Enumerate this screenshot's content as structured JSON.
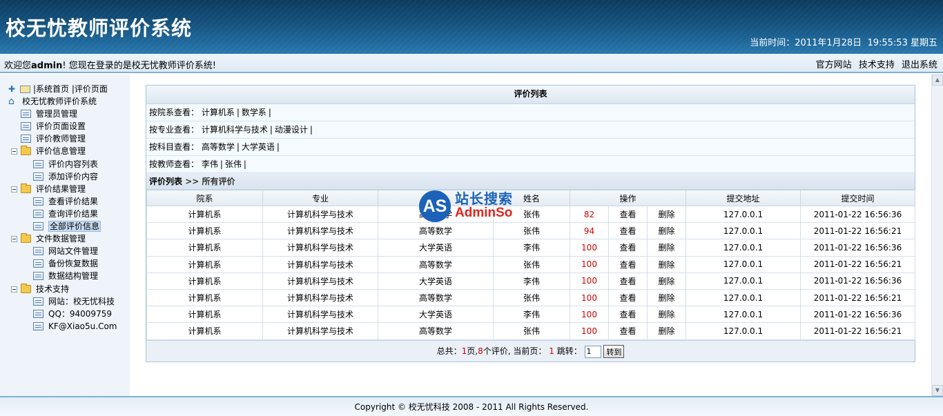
{
  "header": {
    "title": "校无忧教师评价系统",
    "clock_label": "当前时间：",
    "clock_date": "2011年1月28日",
    "clock_time": "19:55:53",
    "clock_weekday": "星期五"
  },
  "welcome": {
    "prefix": "欢迎您",
    "user": "admin",
    "suffix": "! 您现在登录的是校无忧教师评价系统!",
    "links": [
      "官方网站",
      "技术支持",
      "退出系统"
    ]
  },
  "sidebar": {
    "top_links": [
      "系统首页",
      "评价页面"
    ],
    "root": "校无忧教师评价系统",
    "items": [
      {
        "label": "管理员管理",
        "level": 1,
        "type": "doc"
      },
      {
        "label": "评价页面设置",
        "level": 1,
        "type": "doc"
      },
      {
        "label": "评价教师管理",
        "level": 1,
        "type": "doc"
      },
      {
        "label": "评价信息管理",
        "level": 1,
        "type": "folder"
      },
      {
        "label": "评价内容列表",
        "level": 2,
        "type": "doc"
      },
      {
        "label": "添加评价内容",
        "level": 2,
        "type": "doc"
      },
      {
        "label": "评价结果管理",
        "level": 1,
        "type": "folder"
      },
      {
        "label": "查看评价结果",
        "level": 2,
        "type": "doc"
      },
      {
        "label": "查询评价结果",
        "level": 2,
        "type": "doc"
      },
      {
        "label": "全部评价信息",
        "level": 2,
        "type": "doc",
        "active": true
      },
      {
        "label": "文件数据管理",
        "level": 1,
        "type": "folder"
      },
      {
        "label": "网站文件管理",
        "level": 2,
        "type": "doc"
      },
      {
        "label": "备份恢复数据",
        "level": 2,
        "type": "doc"
      },
      {
        "label": "数据结构管理",
        "level": 2,
        "type": "doc"
      },
      {
        "label": "技术支持",
        "level": 1,
        "type": "folder"
      },
      {
        "label": "网站：校无忧科技",
        "level": 2,
        "type": "doc"
      },
      {
        "label": "QQ：94009759",
        "level": 2,
        "type": "doc"
      },
      {
        "label": "KF@Xiao5u.Com",
        "level": 2,
        "type": "doc"
      }
    ]
  },
  "panel": {
    "title": "评价列表",
    "filters": [
      {
        "label": "按院系查看：",
        "options": [
          "计算机系",
          "数学系"
        ]
      },
      {
        "label": "按专业查看：",
        "options": [
          "计算机科学与技术",
          "动漫设计"
        ]
      },
      {
        "label": "按科目查看：",
        "options": [
          "高等数学",
          "大学英语"
        ]
      },
      {
        "label": "按教师查看：",
        "options": [
          "李伟",
          "张伟"
        ]
      }
    ],
    "crumb_main": "评价列表",
    "crumb_sub": ">> 所有评价",
    "columns": [
      "院系",
      "专业",
      "科目",
      "姓名",
      "操作",
      "提交地址",
      "提交时间"
    ],
    "view_label": "查看",
    "delete_label": "删除",
    "rows": [
      {
        "dept": "计算机系",
        "major": "计算机科学与技术",
        "subject": "高等数学",
        "teacher": "张伟",
        "score": "82",
        "ip": "127.0.0.1",
        "time": "2011-01-22 16:56:36"
      },
      {
        "dept": "计算机系",
        "major": "计算机科学与技术",
        "subject": "高等数学",
        "teacher": "张伟",
        "score": "94",
        "ip": "127.0.0.1",
        "time": "2011-01-22 16:56:21"
      },
      {
        "dept": "计算机系",
        "major": "计算机科学与技术",
        "subject": "大学英语",
        "teacher": "李伟",
        "score": "100",
        "ip": "127.0.0.1",
        "time": "2011-01-22 16:56:36"
      },
      {
        "dept": "计算机系",
        "major": "计算机科学与技术",
        "subject": "高等数学",
        "teacher": "张伟",
        "score": "100",
        "ip": "127.0.0.1",
        "time": "2011-01-22 16:56:21"
      },
      {
        "dept": "计算机系",
        "major": "计算机科学与技术",
        "subject": "大学英语",
        "teacher": "李伟",
        "score": "100",
        "ip": "127.0.0.1",
        "time": "2011-01-22 16:56:36"
      },
      {
        "dept": "计算机系",
        "major": "计算机科学与技术",
        "subject": "高等数学",
        "teacher": "张伟",
        "score": "100",
        "ip": "127.0.0.1",
        "time": "2011-01-22 16:56:21"
      },
      {
        "dept": "计算机系",
        "major": "计算机科学与技术",
        "subject": "大学英语",
        "teacher": "李伟",
        "score": "100",
        "ip": "127.0.0.1",
        "time": "2011-01-22 16:56:36"
      },
      {
        "dept": "计算机系",
        "major": "计算机科学与技术",
        "subject": "高等数学",
        "teacher": "张伟",
        "score": "100",
        "ip": "127.0.0.1",
        "time": "2011-01-22 16:56:21"
      }
    ],
    "pager": {
      "total_label": "总共：",
      "pages": "1",
      "pages_unit": "页,",
      "count": "8",
      "count_unit": "个评价, 当前页：",
      "current": "1",
      "jump_label": "跳转：",
      "jump_value": "1",
      "go_label": "转到"
    }
  },
  "watermark": {
    "logo": "AS",
    "cn": "站长搜索",
    "en": "AdminSo"
  },
  "footer": {
    "copyright": "Copyright © 校无忧科技  2008 - 2011 All Rights Reserved."
  },
  "colors": {
    "header_bg": "#15527d",
    "score_red": "#d00000",
    "accent_blue": "#7fb0d6"
  }
}
